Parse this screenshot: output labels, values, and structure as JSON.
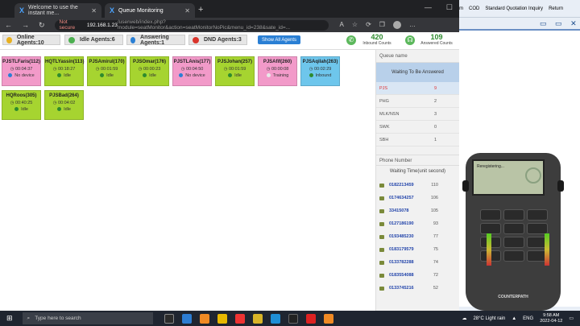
{
  "browser": {
    "tabs": [
      {
        "label": "Welcome to use the instant me..."
      },
      {
        "label": "Queue Monitoring"
      }
    ],
    "url_security": "Not secure",
    "url_host": "192.168.1.23",
    "url_path": "/userweb/index.php?module=seatMonitor&action=seatMonitorNoPic&menu_id=238&sate_id=..."
  },
  "stats": {
    "online": "Online Agents:10",
    "idle": "Idle Agents:6",
    "answering": "Answering Agents:1",
    "dnd": "DND Agents:3",
    "show_all": "Show All Agents",
    "inbound_num": "420",
    "inbound_label": "Inbound Counts",
    "answered_num": "109",
    "answered_label": "Answered Counts"
  },
  "agents": [
    {
      "name": "PJSTLFaris(112)",
      "time": "00:04:37",
      "status": "No device",
      "color": "#f29ac9"
    },
    {
      "name": "HQTLYassin(113)",
      "time": "00:18:27",
      "status": "Idle",
      "color": "#a6d430"
    },
    {
      "name": "PJSAmirul(170)",
      "time": "00:01:59",
      "status": "Idle",
      "color": "#a6d430"
    },
    {
      "name": "PJSOmar(176)",
      "time": "00:00:23",
      "status": "Idle",
      "color": "#a6d430"
    },
    {
      "name": "PJSTLAnis(177)",
      "time": "00:04:50",
      "status": "No device",
      "color": "#f29ac9"
    },
    {
      "name": "PJSJohan(257)",
      "time": "00:01:59",
      "status": "Idle",
      "color": "#a6d430"
    },
    {
      "name": "PJSAfif(260)",
      "time": "00:00:08",
      "status": "Training",
      "color": "#f29ac9"
    },
    {
      "name": "PJSAqilah(263)",
      "time": "00:02:29",
      "status": "Inbound",
      "color": "#6ec6ec"
    },
    {
      "name": "HQRoos(305)",
      "time": "00:40:25",
      "status": "Idle",
      "color": "#a6d430"
    },
    {
      "name": "PJSBad(264)",
      "time": "00:04:02",
      "status": "Idle",
      "color": "#a6d430"
    }
  ],
  "queue": {
    "title": "Queue name",
    "sub": "Waiting To Be Answered",
    "rows": [
      {
        "name": "PJS",
        "value": "9"
      },
      {
        "name": "PHG",
        "value": "2"
      },
      {
        "name": "MLK/NSN",
        "value": "3"
      },
      {
        "name": "SWK",
        "value": "0"
      },
      {
        "name": "SBH",
        "value": "1"
      }
    ]
  },
  "phones": {
    "title": "Phone Number",
    "sub": "Waiting Time(unit second)",
    "rows": [
      {
        "number": "0182213459",
        "value": "110"
      },
      {
        "number": "0174634257",
        "value": "106"
      },
      {
        "number": "33415078",
        "value": "105"
      },
      {
        "number": "0127186190",
        "value": "93"
      },
      {
        "number": "0193485230",
        "value": "77"
      },
      {
        "number": "0183179579",
        "value": "75"
      },
      {
        "number": "0133782288",
        "value": "74"
      },
      {
        "number": "0183554088",
        "value": "72"
      },
      {
        "number": "0133745216",
        "value": "52"
      }
    ]
  },
  "erp": {
    "menu": [
      "m",
      "COD",
      "Standard Quotation Inquiry",
      "Return"
    ]
  },
  "softphone": {
    "screen_text": "Reregistering...",
    "brand": "COUNTERPATH"
  },
  "taskbar": {
    "search_placeholder": "Type here to search",
    "weather": "28°C  Light rain",
    "lang": "ENG",
    "time": "9:58 AM",
    "date": "2022-04-12"
  }
}
